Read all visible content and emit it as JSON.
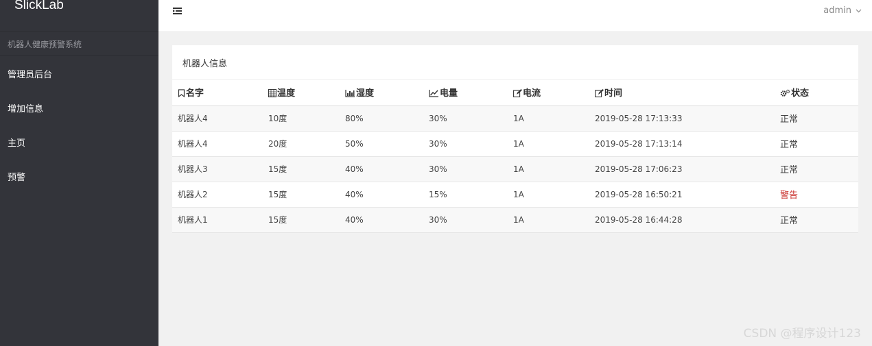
{
  "sidebar": {
    "brand": "SlickLab",
    "subtitle": "机器人健康预警系统",
    "items": [
      {
        "label": "管理员后台"
      },
      {
        "label": "增加信息"
      },
      {
        "label": "主页"
      },
      {
        "label": "预警"
      }
    ]
  },
  "topbar": {
    "user": "admin"
  },
  "panel": {
    "title": "机器人信息",
    "columns": [
      {
        "label": "名字",
        "icon": "bookmark-icon"
      },
      {
        "label": "温度",
        "icon": "calendar-grid-icon"
      },
      {
        "label": "湿度",
        "icon": "bar-chart-icon"
      },
      {
        "label": "电量",
        "icon": "line-chart-icon"
      },
      {
        "label": "电流",
        "icon": "edit-icon"
      },
      {
        "label": "时间",
        "icon": "edit-icon"
      },
      {
        "label": "状态",
        "icon": "gears-icon"
      }
    ],
    "rows": [
      {
        "name": "机器人4",
        "temp": "10度",
        "humidity": "80%",
        "battery": "30%",
        "current": "1A",
        "time": "2019-05-28 17:13:33",
        "status": "正常"
      },
      {
        "name": "机器人4",
        "temp": "20度",
        "humidity": "50%",
        "battery": "30%",
        "current": "1A",
        "time": "2019-05-28 17:13:14",
        "status": "正常"
      },
      {
        "name": "机器人3",
        "temp": "15度",
        "humidity": "40%",
        "battery": "30%",
        "current": "1A",
        "time": "2019-05-28 17:06:23",
        "status": "正常"
      },
      {
        "name": "机器人2",
        "temp": "15度",
        "humidity": "40%",
        "battery": "15%",
        "current": "1A",
        "time": "2019-05-28 16:50:21",
        "status": "警告"
      },
      {
        "name": "机器人1",
        "temp": "15度",
        "humidity": "40%",
        "battery": "30%",
        "current": "1A",
        "time": "2019-05-28 16:44:28",
        "status": "正常"
      }
    ]
  },
  "colors": {
    "sidebar_bg": "#33343a",
    "warning": "#c9302c",
    "normal": "#444444"
  },
  "watermark": "CSDN @程序设计123"
}
